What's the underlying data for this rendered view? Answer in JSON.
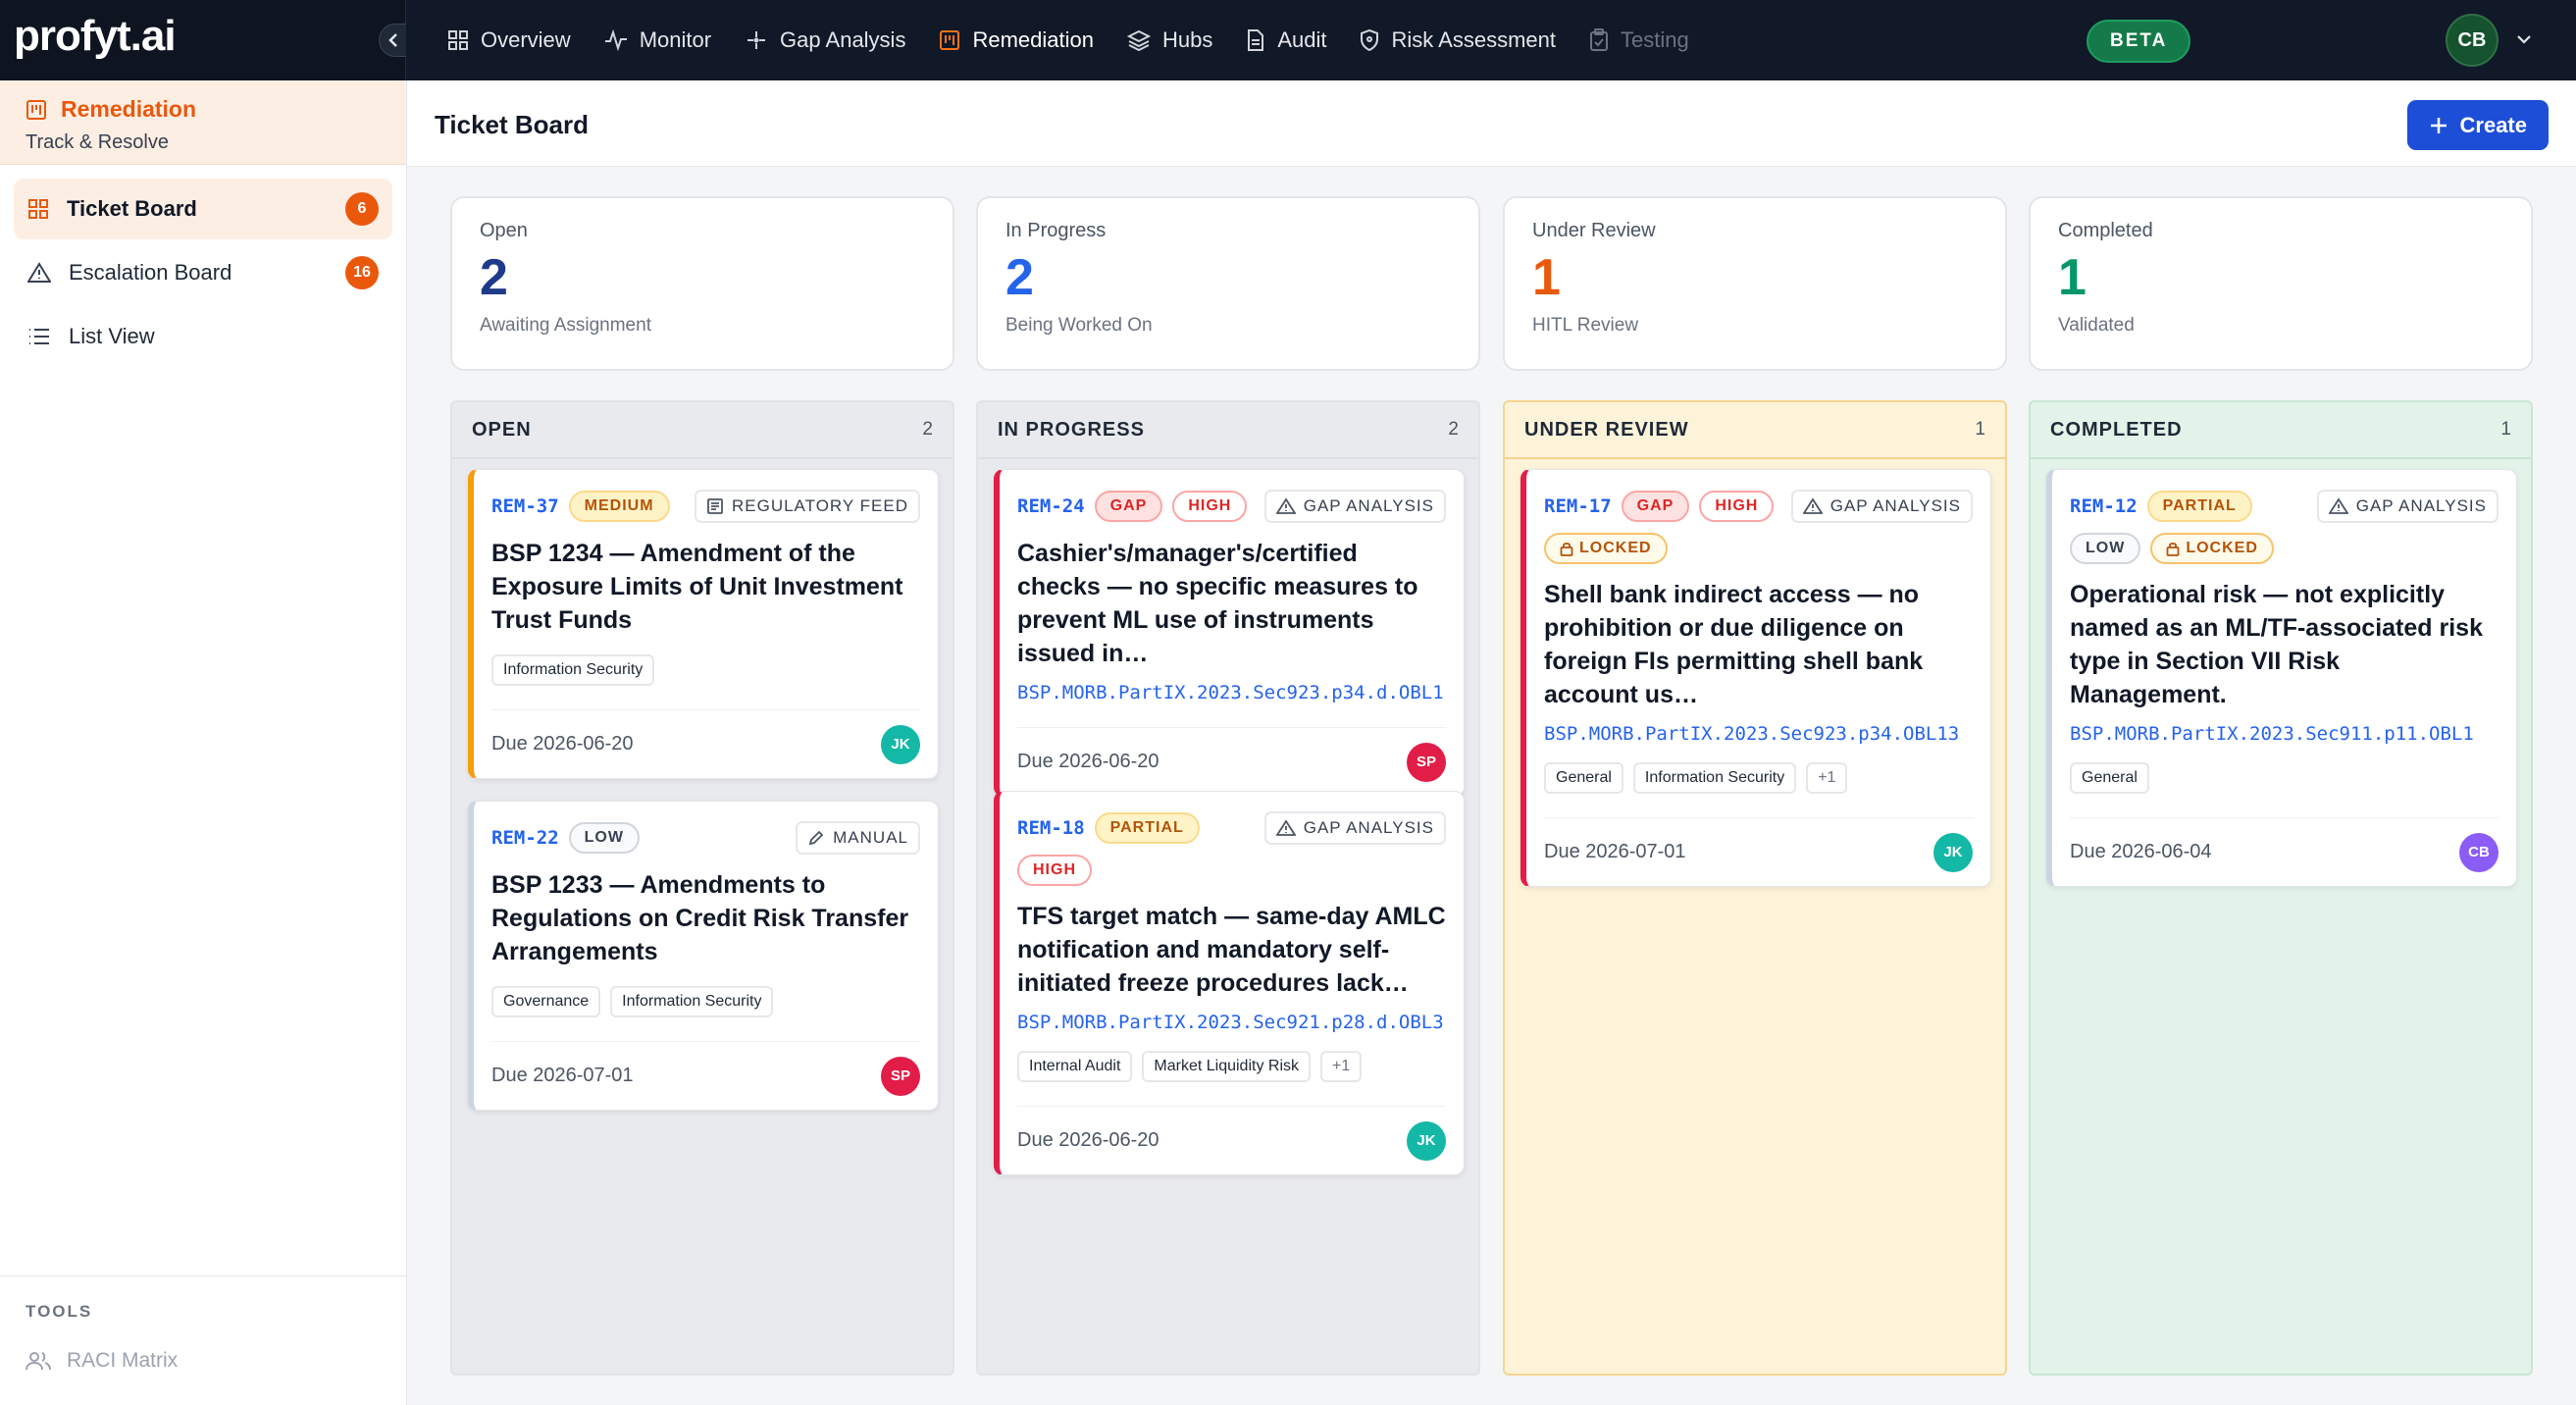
{
  "brand": "profyt.ai",
  "nav": [
    {
      "label": "Overview",
      "icon": "grid-icon"
    },
    {
      "label": "Monitor",
      "icon": "activity-icon"
    },
    {
      "label": "Gap Analysis",
      "icon": "sparkle-icon"
    },
    {
      "label": "Remediation",
      "icon": "clipboard-icon"
    },
    {
      "label": "Hubs",
      "icon": "layers-icon"
    },
    {
      "label": "Audit",
      "icon": "file-icon"
    },
    {
      "label": "Risk Assessment",
      "icon": "shield-icon"
    },
    {
      "label": "Testing",
      "icon": "clipboard-check-icon"
    }
  ],
  "beta": "BETA",
  "user_initials": "CB",
  "sidebar": {
    "title": "Remediation",
    "subtitle": "Track & Resolve",
    "items": [
      {
        "label": "Ticket Board",
        "badge": "6"
      },
      {
        "label": "Escalation Board",
        "badge": "16"
      },
      {
        "label": "List View"
      }
    ],
    "tools_heading": "TOOLS",
    "tools_item": "RACI Matrix"
  },
  "header": {
    "title": "Ticket Board",
    "create": "Create"
  },
  "stats": [
    {
      "label": "Open",
      "value": "2",
      "sub": "Awaiting Assignment",
      "color": "#1e3a8a"
    },
    {
      "label": "In Progress",
      "value": "2",
      "sub": "Being Worked On",
      "color": "#2563eb"
    },
    {
      "label": "Under Review",
      "value": "1",
      "sub": "HITL Review",
      "color": "#ea580c"
    },
    {
      "label": "Completed",
      "value": "1",
      "sub": "Validated",
      "color": "#059669"
    }
  ],
  "columns": [
    {
      "title": "OPEN",
      "count": "2"
    },
    {
      "title": "IN PROGRESS",
      "count": "2"
    },
    {
      "title": "UNDER REVIEW",
      "count": "1"
    },
    {
      "title": "COMPLETED",
      "count": "1"
    }
  ],
  "cards": {
    "rem37": {
      "id": "REM-37",
      "severity": "MEDIUM",
      "source": "REGULATORY FEED",
      "title": "BSP 1234 — Amendment of the Exposure Limits of Unit Investment Trust Funds",
      "tag1": "Information Security",
      "due": "Due 2026-06-20",
      "assignee": "JK"
    },
    "rem22": {
      "id": "REM-22",
      "severity": "LOW",
      "source": "MANUAL",
      "title": "BSP 1233 — Amendments to Regulations on Credit Risk Transfer Arrangements",
      "tag1": "Governance",
      "tag2": "Information Security",
      "due": "Due 2026-07-01",
      "assignee": "SP"
    },
    "rem24": {
      "id": "REM-24",
      "status": "GAP",
      "severity": "HIGH",
      "source": "GAP ANALYSIS",
      "title": "Cashier's/manager's/certified checks — no specific measures to prevent ML use of instruments issued in…",
      "ref": "BSP.MORB.PartIX.2023.Sec923.p34.d.OBL1",
      "due": "Due 2026-06-20",
      "assignee": "SP"
    },
    "rem18": {
      "id": "REM-18",
      "status": "PARTIAL",
      "severity": "HIGH",
      "source": "GAP ANALYSIS",
      "title": "TFS target match — same-day AMLC notification and mandatory self-initiated freeze procedures lack…",
      "ref": "BSP.MORB.PartIX.2023.Sec921.p28.d.OBL3",
      "tag1": "Internal Audit",
      "tag2": "Market Liquidity Risk",
      "more": "+1",
      "due": "Due 2026-06-20",
      "assignee": "JK"
    },
    "rem17": {
      "id": "REM-17",
      "status": "GAP",
      "severity": "HIGH",
      "source": "GAP ANALYSIS",
      "locked": "LOCKED",
      "title": "Shell bank indirect access — no prohibition or due diligence on foreign FIs permitting shell bank account us…",
      "ref": "BSP.MORB.PartIX.2023.Sec923.p34.OBL13",
      "tag1": "General",
      "tag2": "Information Security",
      "more": "+1",
      "due": "Due 2026-07-01",
      "assignee": "JK"
    },
    "rem12": {
      "id": "REM-12",
      "status": "PARTIAL",
      "severity": "LOW",
      "source": "GAP ANALYSIS",
      "locked": "LOCKED",
      "title": "Operational risk — not explicitly named as an ML/TF-associated risk type in Section VII Risk Management.",
      "ref": "BSP.MORB.PartIX.2023.Sec911.p11.OBL1",
      "tag1": "General",
      "due": "Due 2026-06-04",
      "assignee": "CB"
    }
  },
  "colors": {
    "accent": "#ea580c",
    "primary": "#1d4ed8",
    "link": "#2563eb"
  }
}
